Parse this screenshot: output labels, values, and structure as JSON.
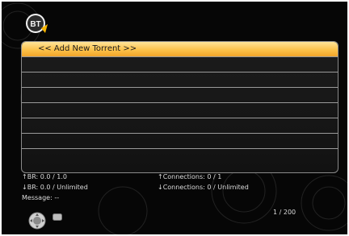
{
  "list": {
    "rows": [
      {
        "label": "<< Add New Torrent >>",
        "selected": true
      },
      {
        "label": ""
      },
      {
        "label": ""
      },
      {
        "label": ""
      },
      {
        "label": ""
      },
      {
        "label": ""
      },
      {
        "label": ""
      },
      {
        "label": ""
      }
    ]
  },
  "status": {
    "up_br_label": "↑BR:",
    "up_br_value": "0.0 /  1.0",
    "down_br_label": "↓BR:",
    "down_br_value": "0.0 / Unlimited",
    "up_conn_label": "↑Connections:",
    "up_conn_value": "0 / 1",
    "down_conn_label": "↓Connections:",
    "down_conn_value": "0 / Unlimited",
    "message_label": "Message:",
    "message_value": "--",
    "page_counter": "1 / 200"
  },
  "colors": {
    "background": "#060606",
    "selection": "#fcc24a",
    "text": "#dcdcdc"
  },
  "icons": [
    "bittorrent-logo-icon",
    "navigation-pad-icon",
    "ok-button-icon"
  ]
}
